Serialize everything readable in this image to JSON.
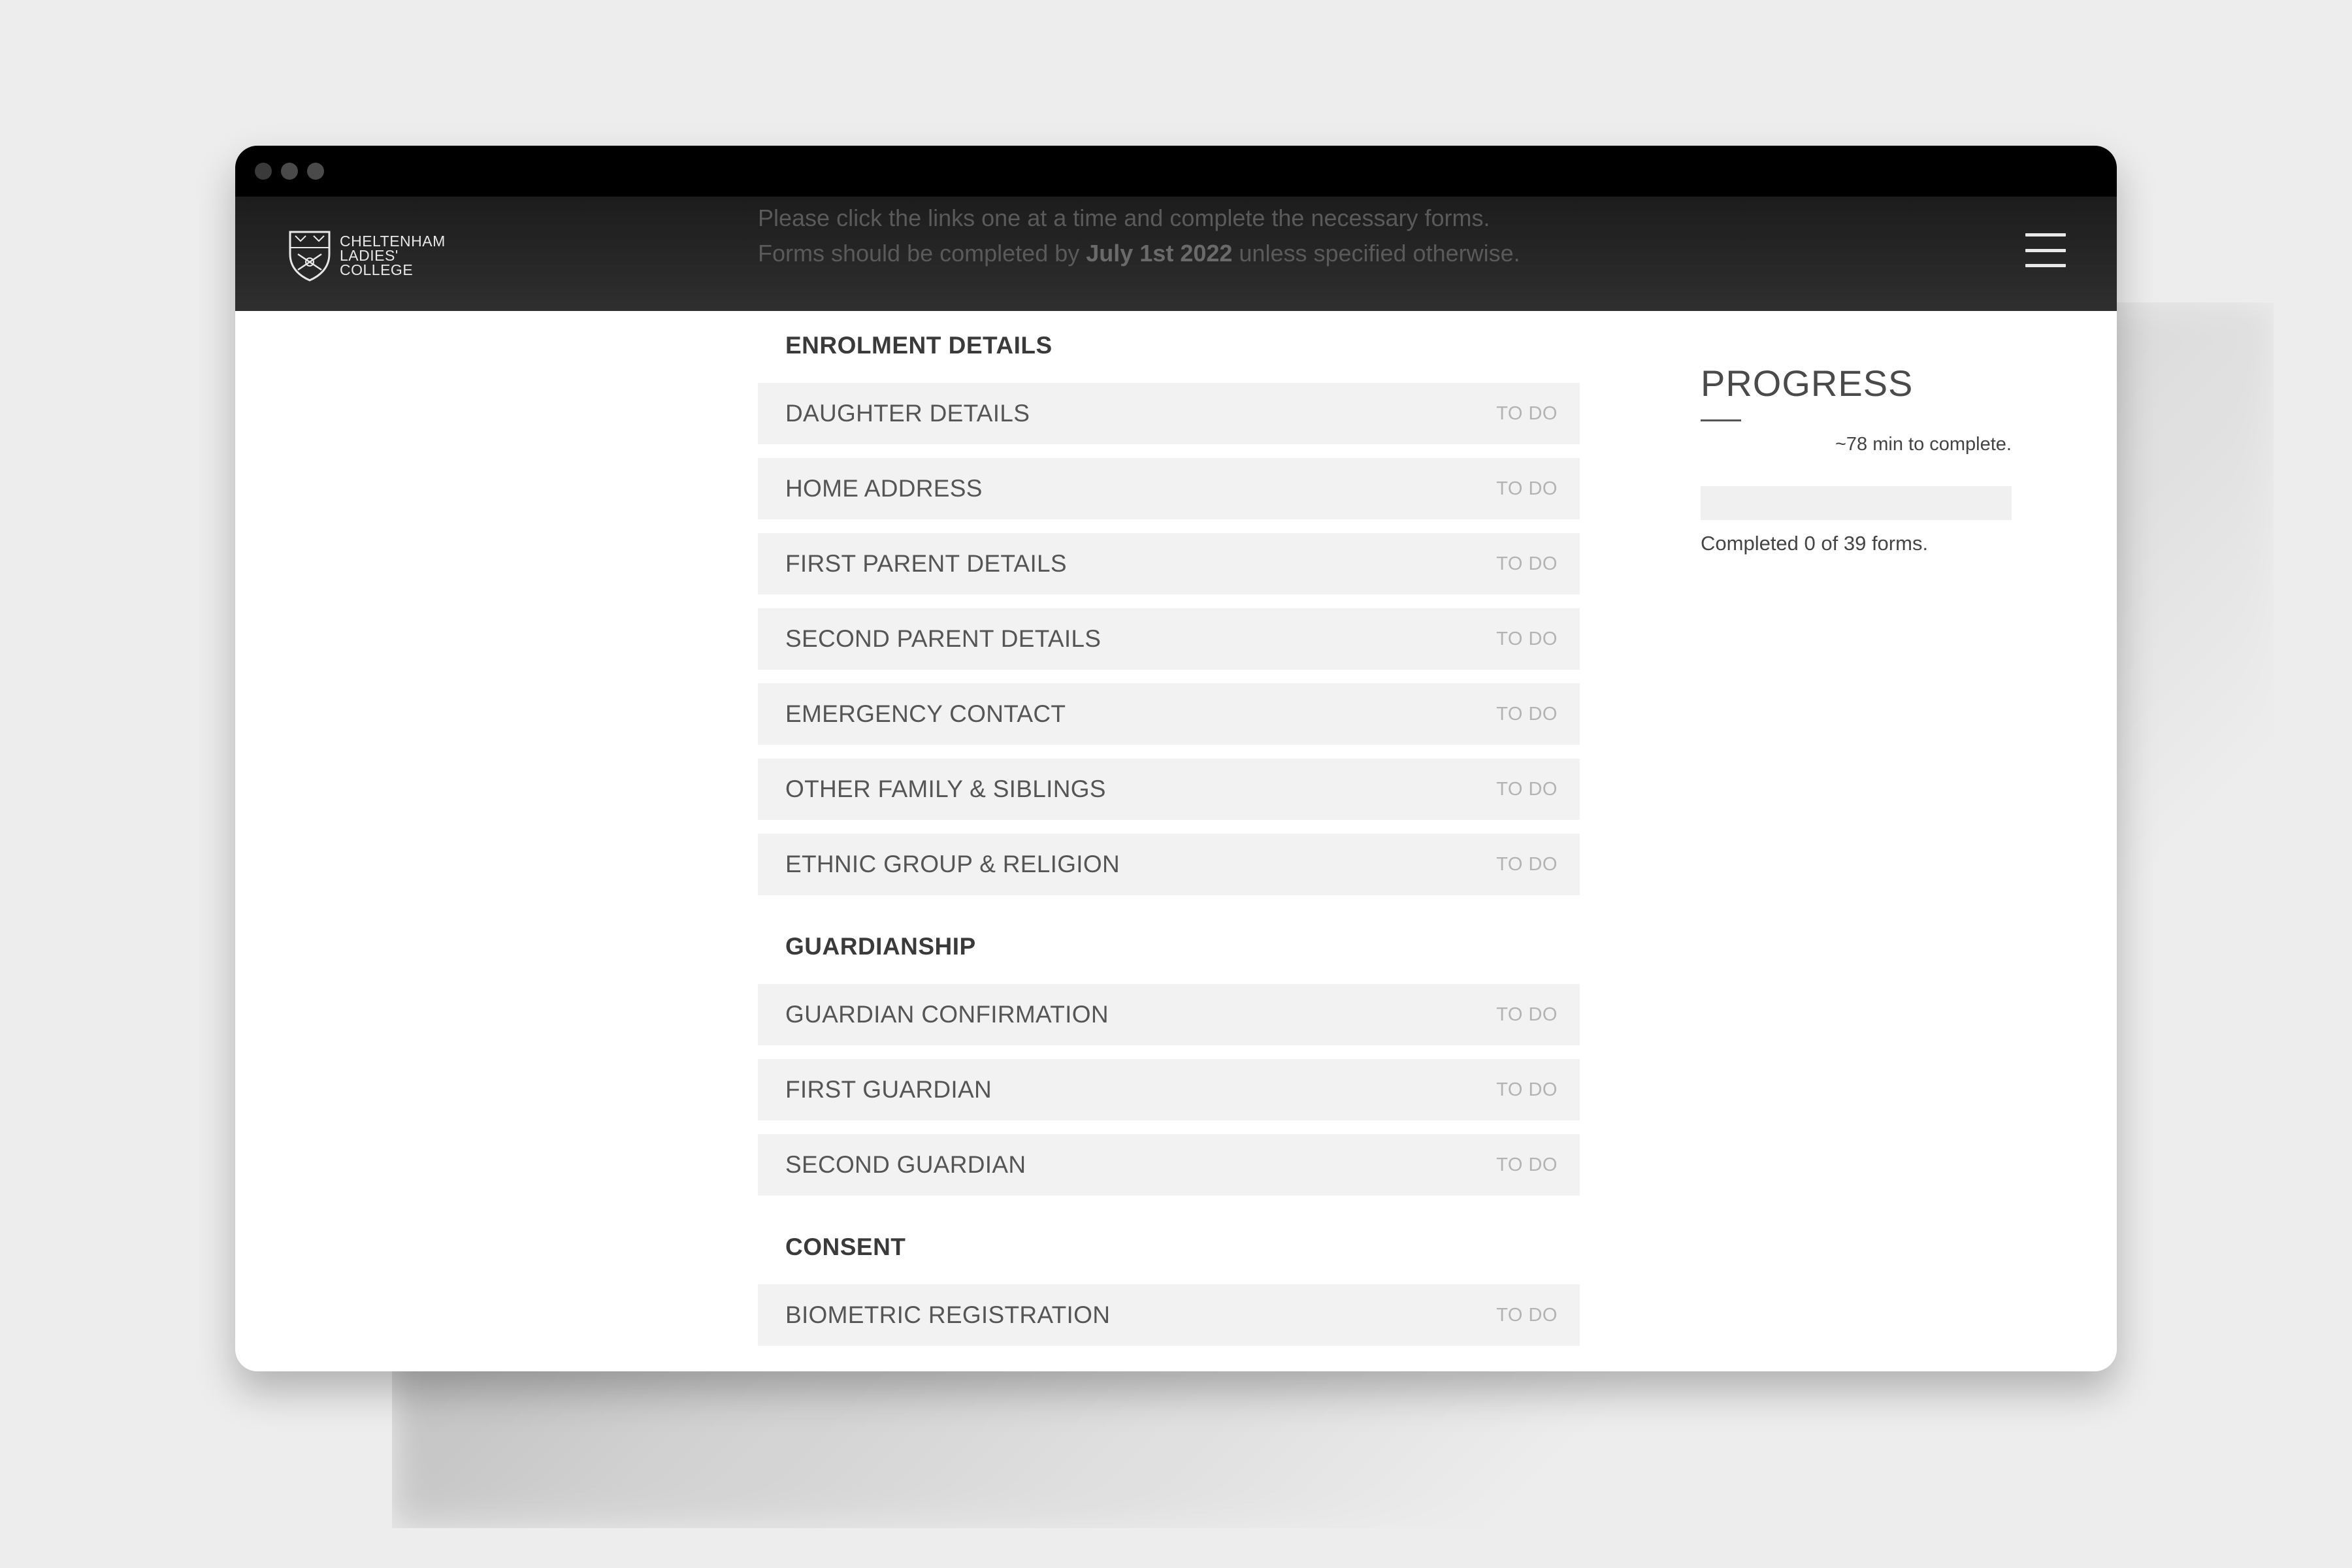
{
  "window": {
    "controls": [
      "close-dot",
      "minimize-dot",
      "maximize-dot"
    ]
  },
  "header": {
    "logo": {
      "line1": "CHELTENHAM",
      "line2": "LADIES'",
      "line3": "COLLEGE"
    },
    "intro_line1": "Please click the links one at a time and complete the necessary forms.",
    "intro_line2_prefix": "Forms should be completed by ",
    "intro_line2_date": "July 1st 2022",
    "intro_line2_suffix": " unless specified otherwise.",
    "menu_icon": "hamburger-icon"
  },
  "sections": [
    {
      "title": "ENROLMENT DETAILS",
      "items": [
        {
          "label": "DAUGHTER DETAILS",
          "status": "TO DO"
        },
        {
          "label": "HOME ADDRESS",
          "status": "TO DO"
        },
        {
          "label": "FIRST PARENT DETAILS",
          "status": "TO DO"
        },
        {
          "label": "SECOND PARENT DETAILS",
          "status": "TO DO"
        },
        {
          "label": "EMERGENCY CONTACT",
          "status": "TO DO"
        },
        {
          "label": "OTHER FAMILY & SIBLINGS",
          "status": "TO DO"
        },
        {
          "label": "ETHNIC GROUP & RELIGION",
          "status": "TO DO"
        }
      ]
    },
    {
      "title": "GUARDIANSHIP",
      "items": [
        {
          "label": "GUARDIAN CONFIRMATION",
          "status": "TO DO"
        },
        {
          "label": "FIRST GUARDIAN",
          "status": "TO DO"
        },
        {
          "label": "SECOND GUARDIAN",
          "status": "TO DO"
        }
      ]
    },
    {
      "title": "CONSENT",
      "items": [
        {
          "label": "BIOMETRIC REGISTRATION",
          "status": "TO DO"
        }
      ]
    }
  ],
  "progress": {
    "title": "PROGRESS",
    "time_estimate": "~78 min to complete.",
    "completed_text": "Completed 0 of 39 forms.",
    "completed": 0,
    "total": 39
  },
  "colors": {
    "header_bg": "#2a2a2a",
    "titlebar_bg": "#000000",
    "item_bg": "#f2f2f2",
    "status_text": "#b3b3b3"
  }
}
